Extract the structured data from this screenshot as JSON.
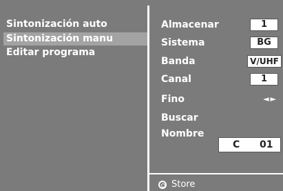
{
  "menu": {
    "items": [
      {
        "label": "Sintonización auto",
        "selected": false
      },
      {
        "label": "Sintonización manu",
        "selected": true
      },
      {
        "label": "Editar programa",
        "selected": false
      }
    ]
  },
  "params": {
    "almacenar": {
      "label": "Almacenar",
      "value": "1"
    },
    "sistema": {
      "label": "Sistema",
      "value": "BG"
    },
    "banda": {
      "label": "Banda",
      "value": "V/UHF"
    },
    "canal": {
      "label": "Canal",
      "value": "1"
    },
    "fino": {
      "label": "Fino",
      "arrows": "◄►"
    },
    "buscar": {
      "label": "Buscar"
    },
    "nombre": {
      "label": "Nombre",
      "channel_prefix": "C",
      "channel_number": "01"
    }
  },
  "footer": {
    "store_icon": "store-button-icon",
    "store_label": "Store"
  },
  "colors": {
    "background": "#7b7b7b",
    "selected": "#a3a3a3",
    "text": "#ffffff",
    "value_box": "#ffffff"
  }
}
